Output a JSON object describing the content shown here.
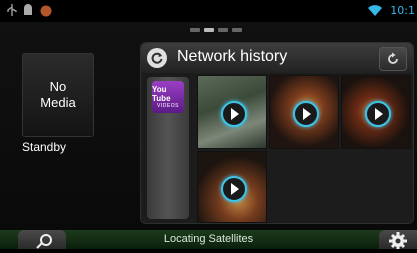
{
  "status_bar": {
    "time": "10:1",
    "icons": [
      "usb-icon",
      "android-debug-icon",
      "notification-badge-icon",
      "wifi-icon"
    ]
  },
  "pager": {
    "pages": 4,
    "active": 1
  },
  "media_tile": {
    "line1": "No",
    "line2": "Media"
  },
  "source_status": "Standby",
  "network_panel": {
    "title": "Network history",
    "source_icon": {
      "name": "youtube-videos-icon",
      "top_text": "You Tube",
      "bottom_text": "VIDEOS"
    },
    "videos": [
      {
        "name": "video-thumb-1"
      },
      {
        "name": "video-thumb-2"
      },
      {
        "name": "video-thumb-3"
      },
      {
        "name": "video-thumb-4"
      }
    ]
  },
  "bottom_bar": {
    "status": "Locating Satellites"
  },
  "colors": {
    "accent": "#3ec2e6",
    "bottom_bar": "#1c3b1c",
    "youtube_purple": "#7b2aa8"
  }
}
